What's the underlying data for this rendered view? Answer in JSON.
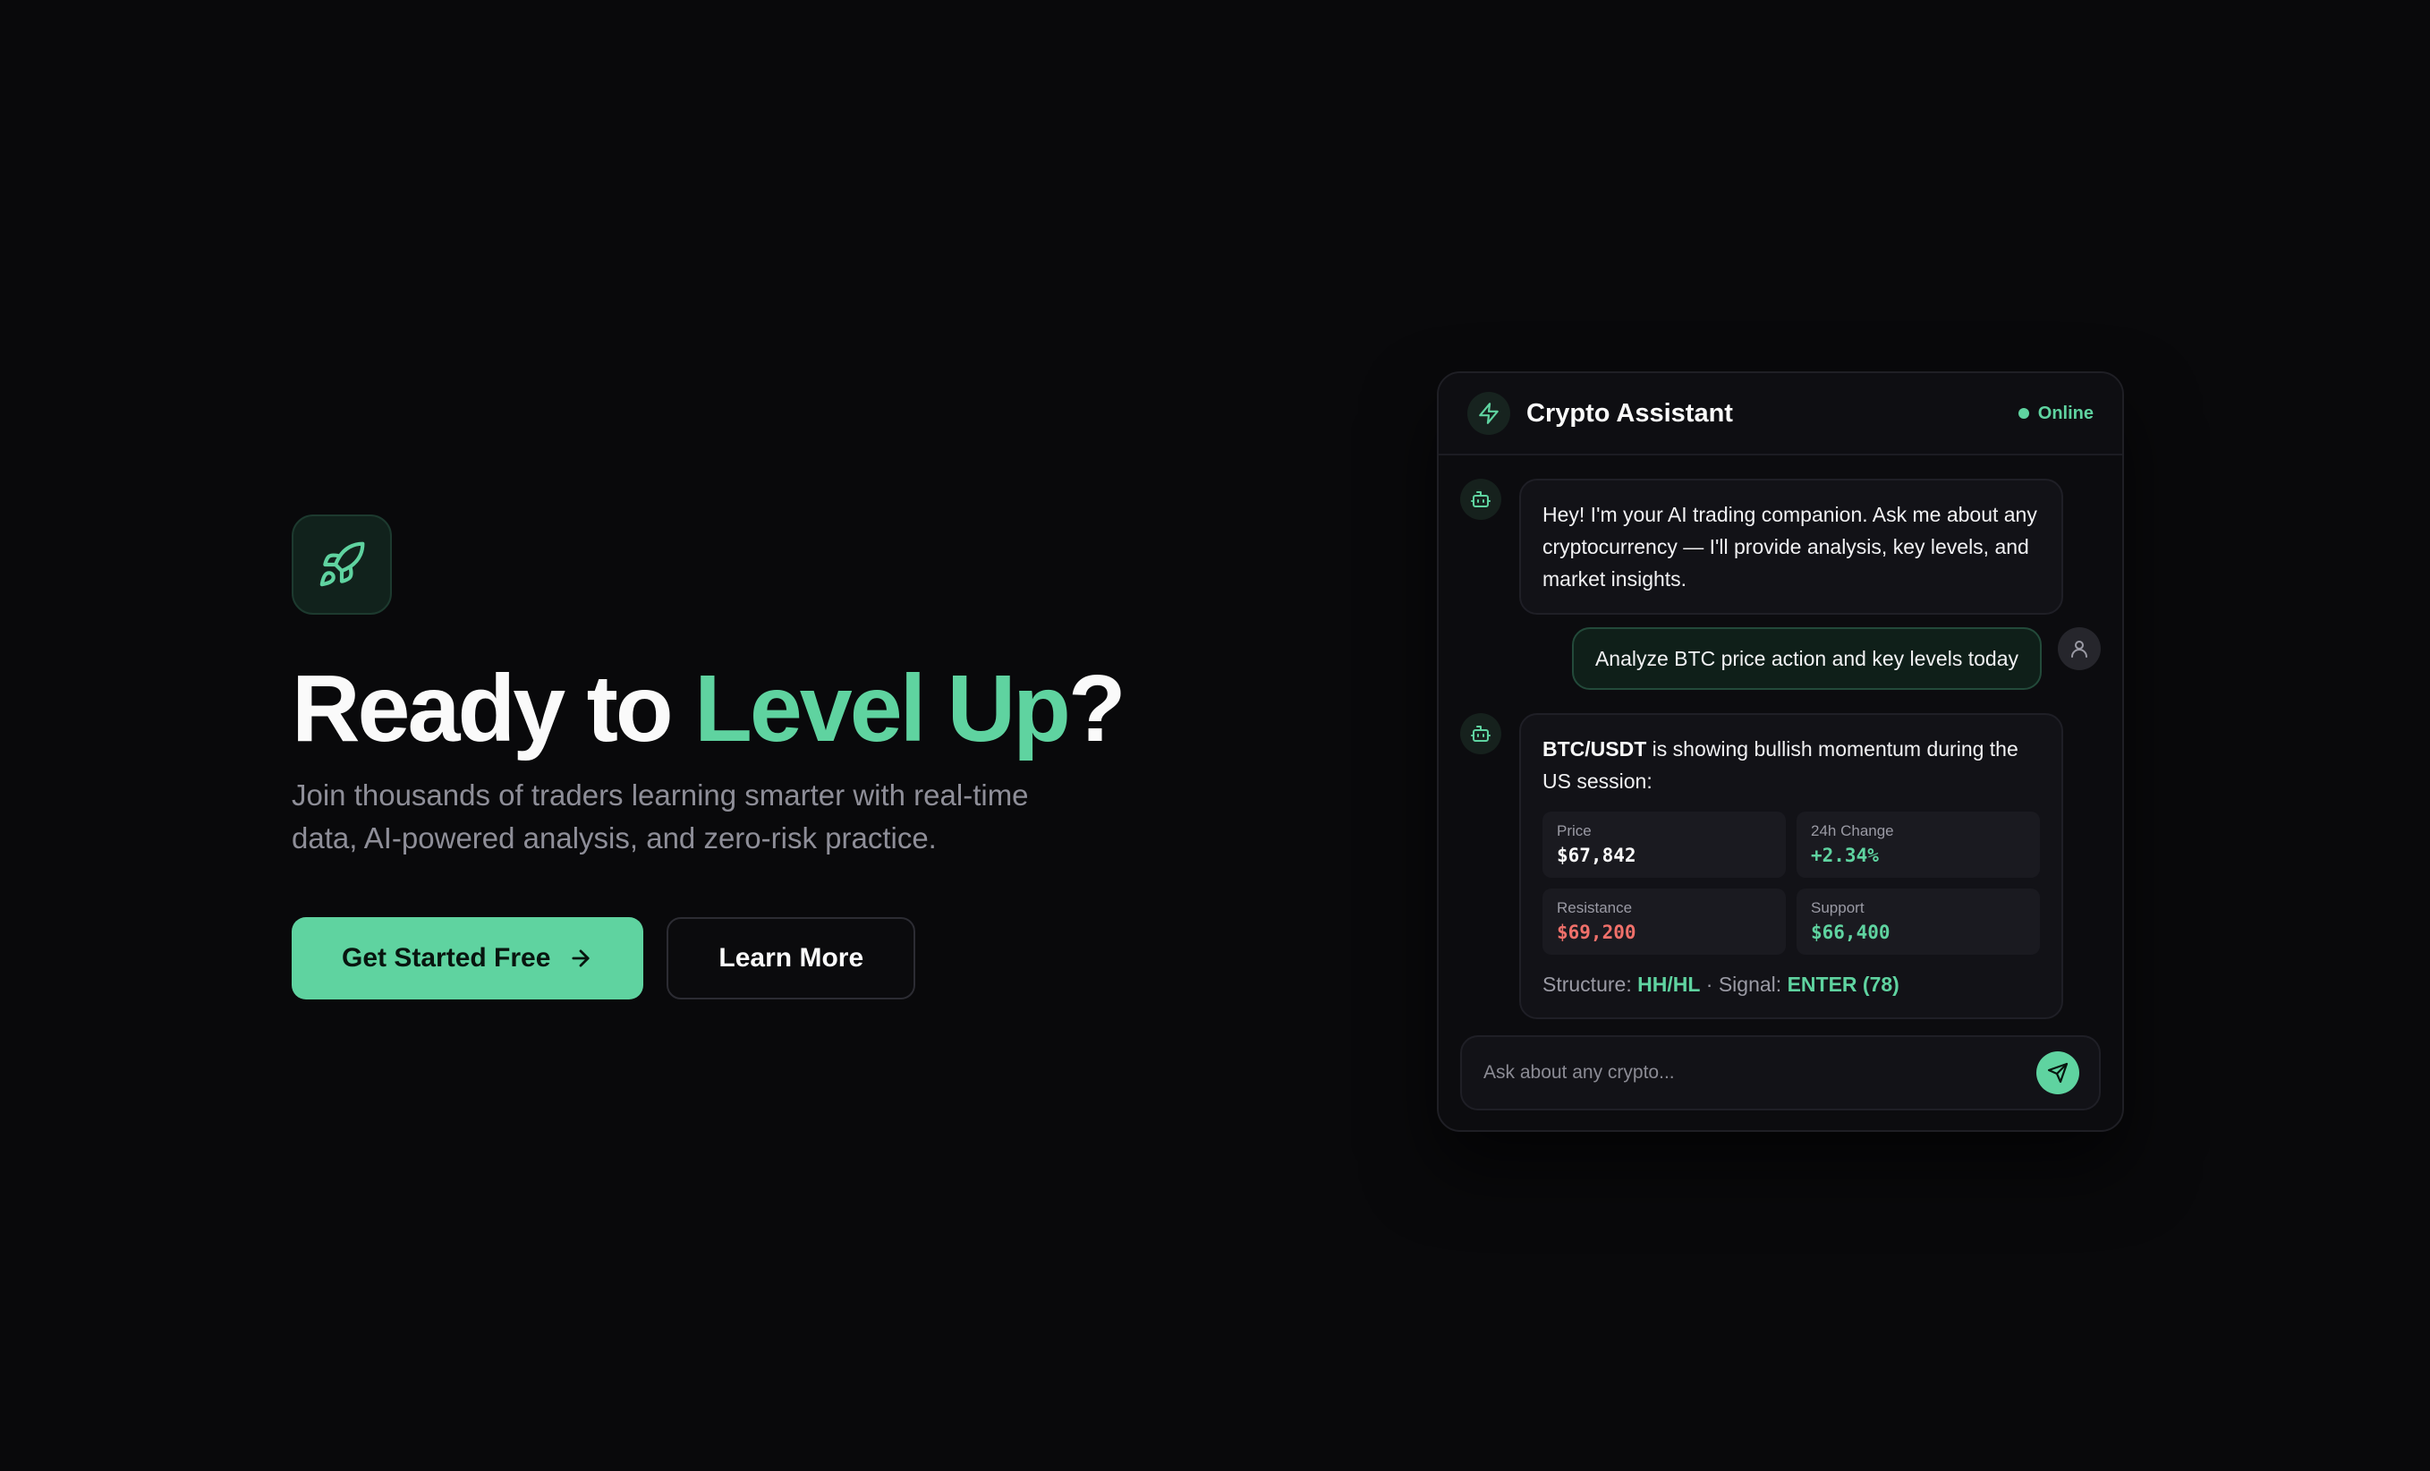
{
  "colors": {
    "accent": "#5fd3a0",
    "background": "#09090b",
    "negative": "#f0706a"
  },
  "hero": {
    "icon": "rocket-icon",
    "title_prefix": "Ready to ",
    "title_accent": "Level Up",
    "title_suffix": "?",
    "subtitle": "Join thousands of traders learning smarter with real-time data, AI-powered analysis, and zero-risk practice.",
    "primary_cta": "Get Started Free",
    "secondary_cta": "Learn More"
  },
  "chat": {
    "title": "Crypto Assistant",
    "header_icon": "lightning-icon",
    "status": "Online",
    "messages": {
      "bot_intro": "Hey! I'm your AI trading companion. Ask me about any cryptocurrency — I'll provide analysis, key levels, and market insights.",
      "user_query": "Analyze BTC price action and key levels today",
      "bot_reply": {
        "pair": "BTC/USDT",
        "text": " is showing bullish momentum during the US session:",
        "stats": [
          {
            "label": "Price",
            "value": "$67,842"
          },
          {
            "label": "24h Change",
            "value": "+2.34%"
          },
          {
            "label": "Resistance",
            "value": "$69,200"
          },
          {
            "label": "Support",
            "value": "$66,400"
          }
        ],
        "structure_label": "Structure: ",
        "structure_value": "HH/HL",
        "separator": " · ",
        "signal_label": "Signal: ",
        "signal_value": "ENTER (78)"
      }
    },
    "input_placeholder": "Ask about any crypto..."
  }
}
